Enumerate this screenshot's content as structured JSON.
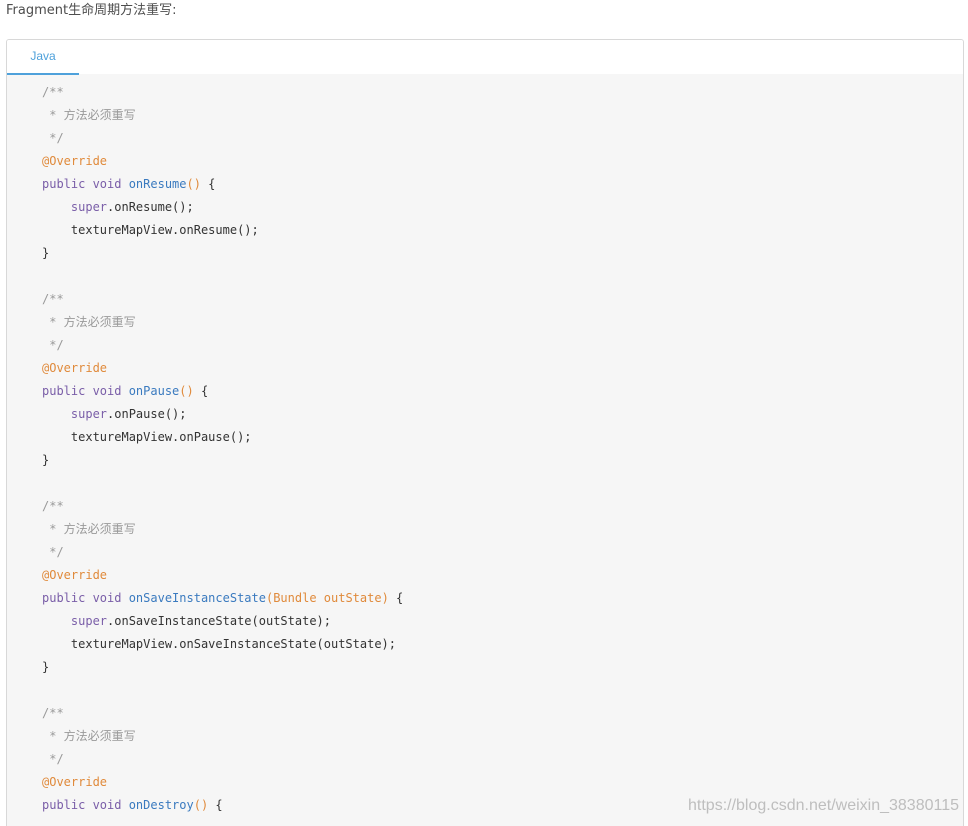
{
  "intro_text": "Fragment生命周期方法重写:",
  "tabs": [
    {
      "label": "Java",
      "active": true
    }
  ],
  "colors": {
    "tab_accent": "#4ea1db",
    "comment": "#999999",
    "annotation": "#e08a3b",
    "keyword": "#7a5ea8",
    "function": "#3a7abf"
  },
  "code_lines": [
    [
      {
        "t": "/**",
        "k": "comment"
      }
    ],
    [
      {
        "t": " * 方法必须重写",
        "k": "comment"
      }
    ],
    [
      {
        "t": " */",
        "k": "comment"
      }
    ],
    [
      {
        "t": "@Override",
        "k": "annot"
      }
    ],
    [
      {
        "t": "public void ",
        "k": "kw"
      },
      {
        "t": "onResume",
        "k": "fn"
      },
      {
        "t": "()",
        "k": "paren"
      },
      {
        "t": " {",
        "k": "plain"
      }
    ],
    [
      {
        "t": "    ",
        "k": "plain"
      },
      {
        "t": "super",
        "k": "kw"
      },
      {
        "t": ".onResume();",
        "k": "plain"
      }
    ],
    [
      {
        "t": "    textureMapView.onResume();",
        "k": "plain"
      }
    ],
    [
      {
        "t": "}",
        "k": "plain"
      }
    ],
    [],
    [
      {
        "t": "/**",
        "k": "comment"
      }
    ],
    [
      {
        "t": " * 方法必须重写",
        "k": "comment"
      }
    ],
    [
      {
        "t": " */",
        "k": "comment"
      }
    ],
    [
      {
        "t": "@Override",
        "k": "annot"
      }
    ],
    [
      {
        "t": "public void ",
        "k": "kw"
      },
      {
        "t": "onPause",
        "k": "fn"
      },
      {
        "t": "()",
        "k": "paren"
      },
      {
        "t": " {",
        "k": "plain"
      }
    ],
    [
      {
        "t": "    ",
        "k": "plain"
      },
      {
        "t": "super",
        "k": "kw"
      },
      {
        "t": ".onPause();",
        "k": "plain"
      }
    ],
    [
      {
        "t": "    textureMapView.onPause();",
        "k": "plain"
      }
    ],
    [
      {
        "t": "}",
        "k": "plain"
      }
    ],
    [],
    [
      {
        "t": "/**",
        "k": "comment"
      }
    ],
    [
      {
        "t": " * 方法必须重写",
        "k": "comment"
      }
    ],
    [
      {
        "t": " */",
        "k": "comment"
      }
    ],
    [
      {
        "t": "@Override",
        "k": "annot"
      }
    ],
    [
      {
        "t": "public void ",
        "k": "kw"
      },
      {
        "t": "onSaveInstanceState",
        "k": "fn"
      },
      {
        "t": "(Bundle outState)",
        "k": "param"
      },
      {
        "t": " {",
        "k": "plain"
      }
    ],
    [
      {
        "t": "    ",
        "k": "plain"
      },
      {
        "t": "super",
        "k": "kw"
      },
      {
        "t": ".onSaveInstanceState(outState);",
        "k": "plain"
      }
    ],
    [
      {
        "t": "    textureMapView.onSaveInstanceState(outState);",
        "k": "plain"
      }
    ],
    [
      {
        "t": "}",
        "k": "plain"
      }
    ],
    [],
    [
      {
        "t": "/**",
        "k": "comment"
      }
    ],
    [
      {
        "t": " * 方法必须重写",
        "k": "comment"
      }
    ],
    [
      {
        "t": " */",
        "k": "comment"
      }
    ],
    [
      {
        "t": "@Override",
        "k": "annot"
      }
    ],
    [
      {
        "t": "public void ",
        "k": "kw"
      },
      {
        "t": "onDestroy",
        "k": "fn"
      },
      {
        "t": "()",
        "k": "paren"
      },
      {
        "t": " {",
        "k": "plain"
      }
    ]
  ],
  "watermark": "https://blog.csdn.net/weixin_38380115"
}
